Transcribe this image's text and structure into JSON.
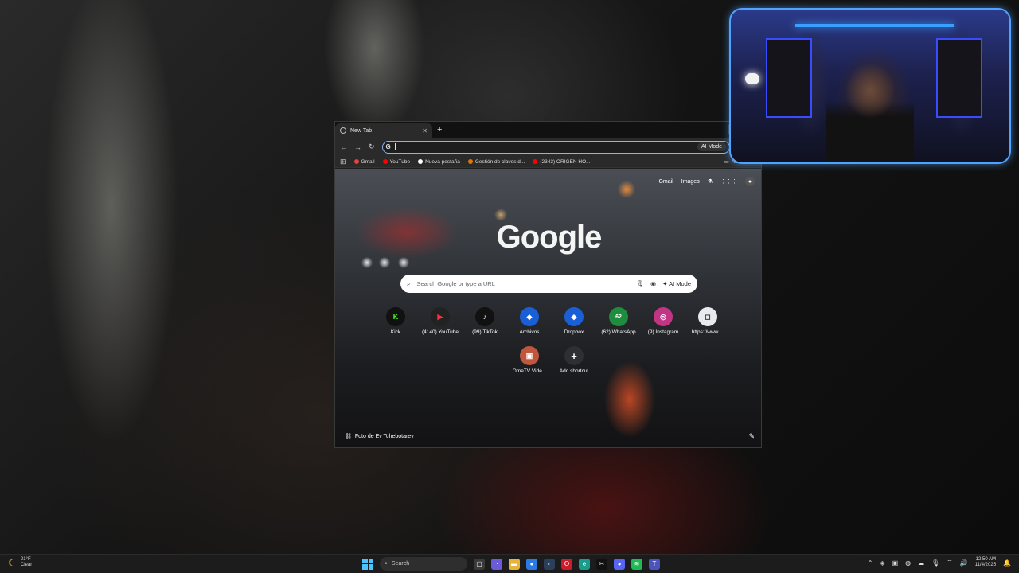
{
  "browser": {
    "tab_title": "New Tab",
    "omnibox_value": "",
    "omnibox_ai_mode": "AI Mode",
    "bookmarks": [
      {
        "label": "Gmail",
        "color": "#ea4335"
      },
      {
        "label": "YouTube",
        "color": "#ff0000"
      },
      {
        "label": "Nueva pestaña",
        "color": "#ffffff"
      },
      {
        "label": "Gestión de claves d...",
        "color": "#e37400"
      },
      {
        "label": "(2343) ORIGEN HO...",
        "color": "#ff0000"
      }
    ],
    "bookmarks_all": "All"
  },
  "ntp": {
    "links": {
      "gmail": "Gmail",
      "images": "Images"
    },
    "logo": "Google",
    "search_placeholder": "Search Google or type a URL",
    "ai_mode": "AI Mode",
    "shortcuts": [
      {
        "label": "Kick",
        "glyph": "K",
        "bg": "#111111",
        "fg": "#53fc18"
      },
      {
        "label": "(4140) YouTube",
        "glyph": "▶",
        "bg": "#222222",
        "fg": "#ff3040"
      },
      {
        "label": "(99) TikTok",
        "glyph": "♪",
        "bg": "#111111",
        "fg": "#ffffff"
      },
      {
        "label": "Archivos",
        "glyph": "◆",
        "bg": "#1a5fd6",
        "fg": "#ffffff"
      },
      {
        "label": "Dropbox",
        "glyph": "◆",
        "bg": "#1a5fd6",
        "fg": "#ffffff"
      },
      {
        "label": "(62) WhatsApp",
        "glyph": "62",
        "bg": "#1e8e3e",
        "fg": "#ffffff"
      },
      {
        "label": "(9) Instagram",
        "glyph": "◎",
        "bg": "#c13584",
        "fg": "#ffffff"
      },
      {
        "label": "https://www....",
        "glyph": "◻",
        "bg": "#e8eaed",
        "fg": "#202124"
      },
      {
        "label": "OmeTV Vide...",
        "glyph": "▣",
        "bg": "#c0563d",
        "fg": "#ffffff"
      },
      {
        "label": "Add shortcut",
        "glyph": "+",
        "bg": "#2d2f33",
        "fg": "#ffffff"
      }
    ],
    "photo_credit": "Foto de Ev Tchebotarev"
  },
  "taskbar": {
    "weather_temp": "21°F",
    "weather_desc": "Clear",
    "search_placeholder": "Search",
    "time": "12:50 AM",
    "date": "11/4/2025"
  },
  "colors": {
    "accent": "#8ab4f8",
    "cam_border": "#4fa3ff",
    "win_accent": "#4cc2ff"
  }
}
